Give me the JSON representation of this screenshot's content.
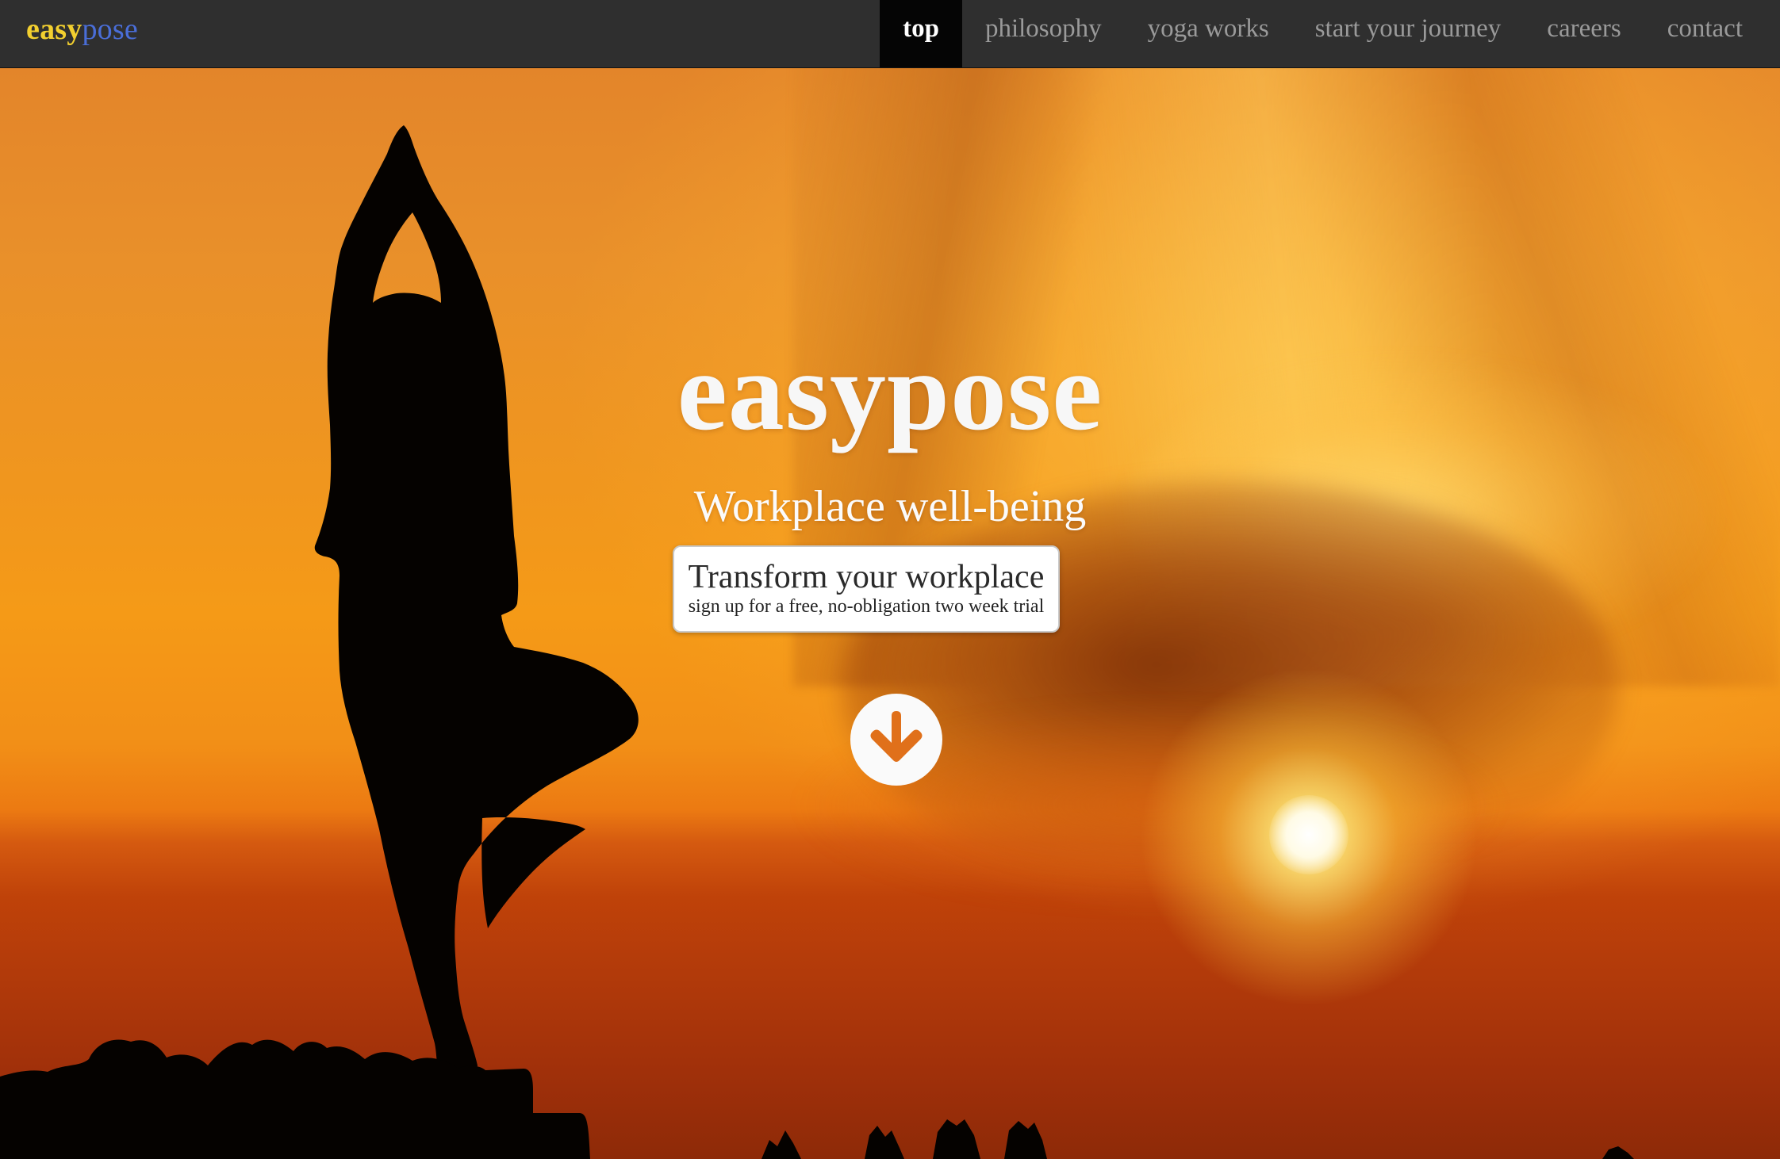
{
  "brand": {
    "logo_part1": "easy",
    "logo_part2": "pose",
    "logo_color_part1": "#f2cf2f",
    "logo_color_part2": "#4a6ed8"
  },
  "nav": {
    "items": [
      {
        "label": "top",
        "active": true
      },
      {
        "label": "philosophy",
        "active": false
      },
      {
        "label": "yoga works",
        "active": false
      },
      {
        "label": "start your journey",
        "active": false
      },
      {
        "label": "careers",
        "active": false
      },
      {
        "label": "contact",
        "active": false
      }
    ]
  },
  "hero": {
    "title": "easypose",
    "subtitle": "Workplace well-being",
    "cta": {
      "label": "Transform your workplace",
      "sublabel": "sign up for a free, no-obligation two week trial"
    },
    "scroll_icon": "arrow-down-circle-icon",
    "background_image": "yoga tree-pose silhouette at sunset"
  }
}
